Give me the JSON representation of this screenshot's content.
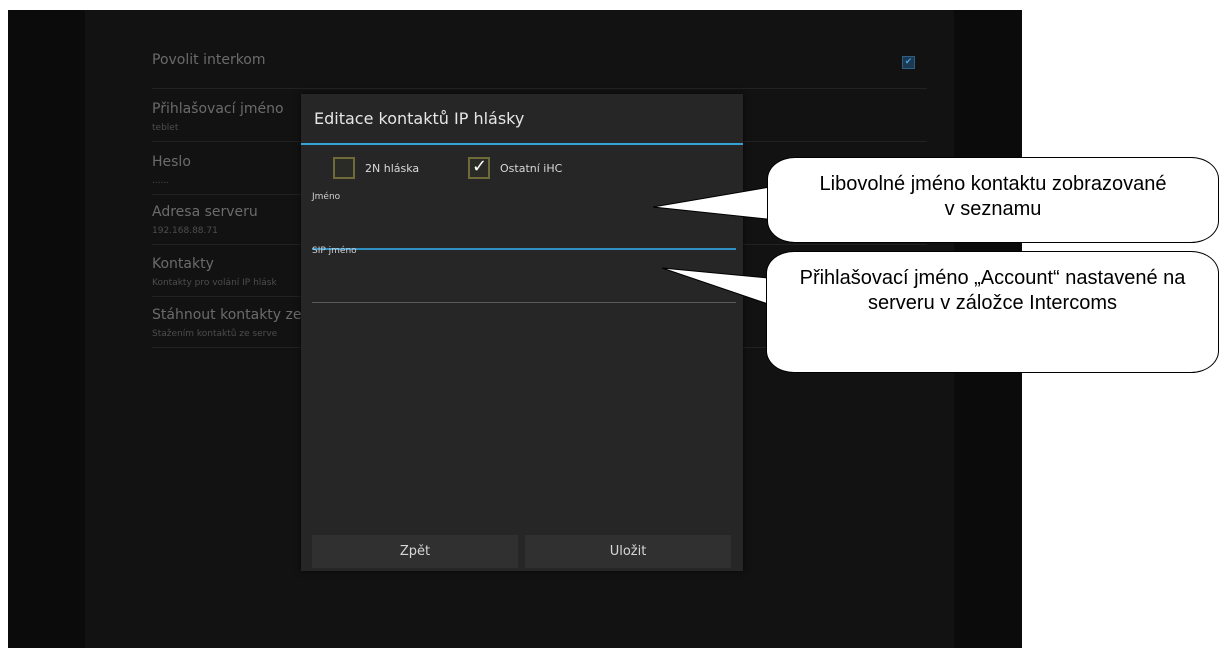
{
  "settings": [
    {
      "title": "Povolit interkom",
      "subtitle": ""
    },
    {
      "title": "Přihlašovací jméno",
      "subtitle": "teblet"
    },
    {
      "title": "Heslo",
      "subtitle": "......"
    },
    {
      "title": "Adresa serveru",
      "subtitle": "192.168.88.71"
    },
    {
      "title": "Kontakty",
      "subtitle": "Kontakty pro volání IP hlásk"
    },
    {
      "title": "Stáhnout kontakty ze s",
      "subtitle": "Stažením kontaktů ze serve"
    }
  ],
  "dialog": {
    "title": "Editace kontaktů IP hlásky",
    "checkbox_2n": {
      "label": "2N hláska",
      "checked": false
    },
    "checkbox_other": {
      "label": "Ostatní iHC",
      "checked": true
    },
    "name_label": "Jméno",
    "name_value": "",
    "sip_label": "SIP jméno",
    "sip_value": "",
    "back_label": "Zpět",
    "save_label": "Uložit"
  },
  "callouts": {
    "first": "Libovolné jméno kontaktu zobrazované v seznamu",
    "second": "Přihlašovací jméno „Account“ nastavené na serveru v záložce Intercoms"
  },
  "colors": {
    "accent": "#33a3d8",
    "background": "#0b0b0b",
    "dialog": "#262626"
  }
}
